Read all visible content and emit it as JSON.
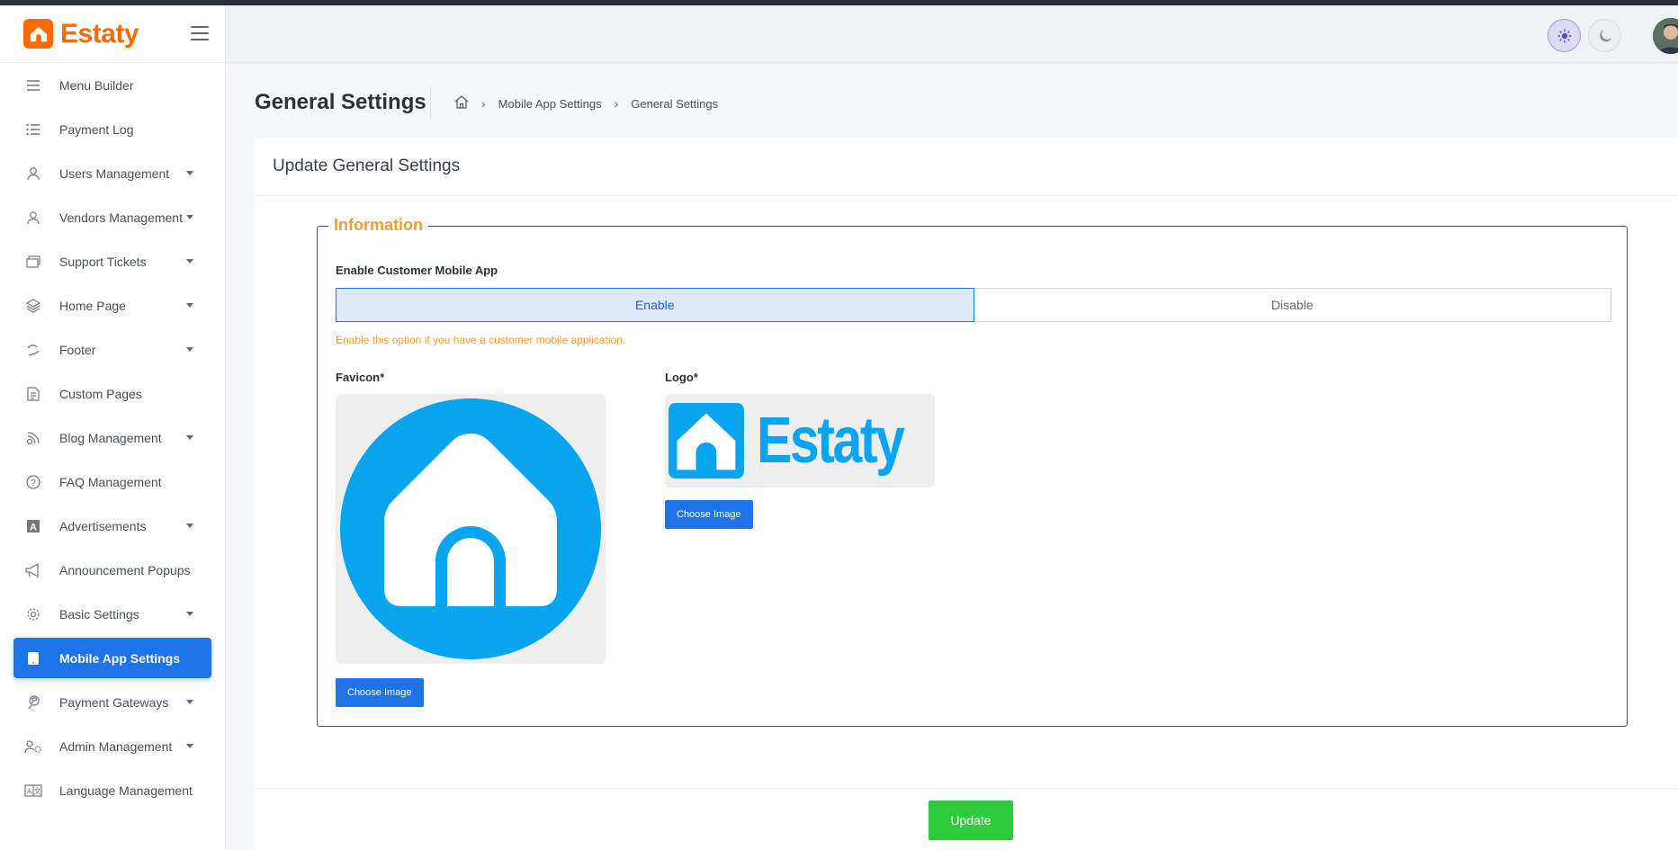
{
  "brand": {
    "name": "Estaty"
  },
  "sidebar": {
    "items": [
      {
        "label": "Menu Builder",
        "icon": "menu-lines-icon",
        "has_caret": false
      },
      {
        "label": "Payment Log",
        "icon": "list-icon",
        "has_caret": false
      },
      {
        "label": "Users Management",
        "icon": "user-icon",
        "has_caret": true
      },
      {
        "label": "Vendors Management",
        "icon": "user-icon",
        "has_caret": true
      },
      {
        "label": "Support Tickets",
        "icon": "ticket-icon",
        "has_caret": true
      },
      {
        "label": "Home Page",
        "icon": "layers-icon",
        "has_caret": true
      },
      {
        "label": "Footer",
        "icon": "footer-icon",
        "has_caret": true
      },
      {
        "label": "Custom Pages",
        "icon": "document-icon",
        "has_caret": false
      },
      {
        "label": "Blog Management",
        "icon": "rss-icon",
        "has_caret": true
      },
      {
        "label": "FAQ Management",
        "icon": "question-icon",
        "has_caret": false
      },
      {
        "label": "Advertisements",
        "icon": "ad-icon",
        "has_caret": true
      },
      {
        "label": "Announcement Popups",
        "icon": "megaphone-icon",
        "has_caret": false
      },
      {
        "label": "Basic Settings",
        "icon": "gear-icon",
        "has_caret": true
      },
      {
        "label": "Mobile App Settings",
        "icon": "tablet-icon",
        "has_caret": false,
        "active": true
      },
      {
        "label": "Payment Gateways",
        "icon": "payment-icon",
        "has_caret": true
      },
      {
        "label": "Admin Management",
        "icon": "users-gear-icon",
        "has_caret": true
      },
      {
        "label": "Language Management",
        "icon": "translate-icon",
        "has_caret": false
      }
    ]
  },
  "page": {
    "title": "General Settings",
    "breadcrumb": {
      "parent": "Mobile App Settings",
      "current": "General Settings"
    }
  },
  "card": {
    "header": "Update General Settings",
    "legend": "Information",
    "enable_label": "Enable Customer Mobile App",
    "toggle": {
      "enable": "Enable",
      "disable": "Disable",
      "selected": "Enable"
    },
    "hint": "Enable this option if you have a customer mobile application.",
    "favicon_label": "Favicon*",
    "logo_label": "Logo*",
    "logo_text": "Estaty",
    "choose_image": "Choose Image",
    "update_button": "Update"
  },
  "colors": {
    "brand_orange": "#ff6a00",
    "primary_blue": "#1e73e8",
    "accent_orange": "#f39c34",
    "logo_blue": "#07a5f0",
    "update_green": "#2ecc3a"
  }
}
